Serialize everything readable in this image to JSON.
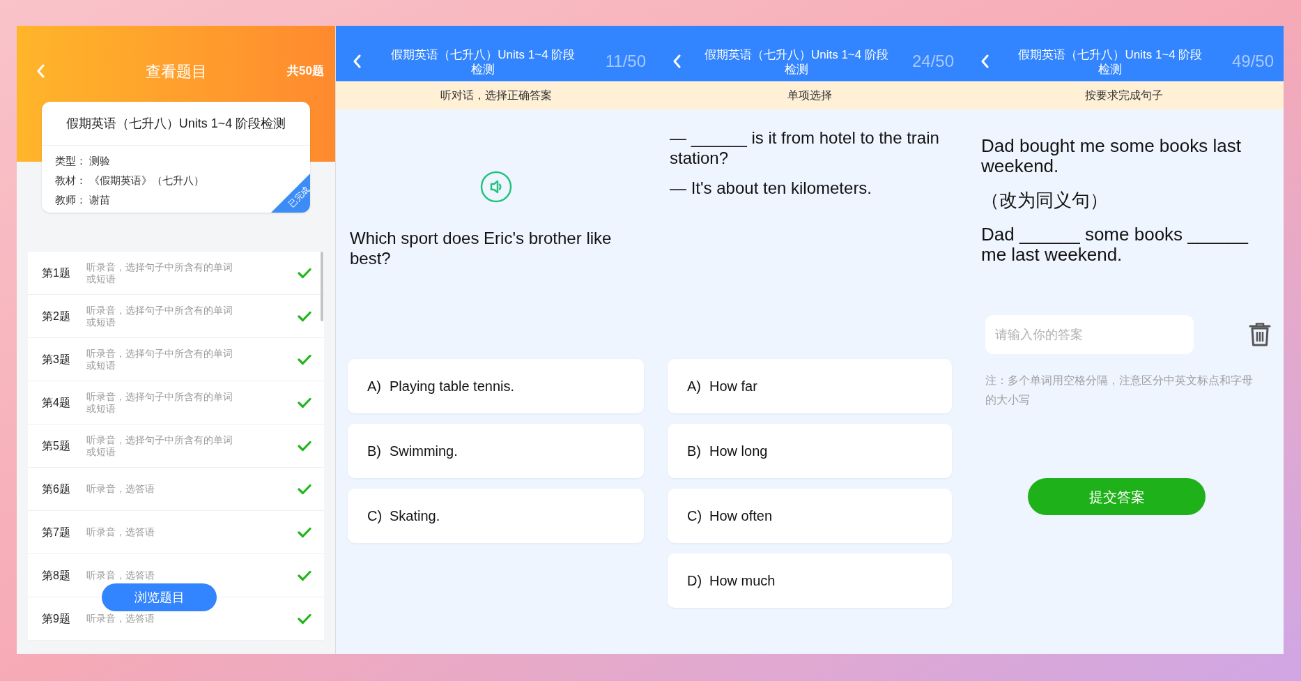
{
  "overview_screen": {
    "title": "查看题目",
    "total": "共50题",
    "card": {
      "title": "假期英语（七升八）Units 1~4 阶段检测",
      "fields": [
        {
          "label": "类型：",
          "value": "测验"
        },
        {
          "label": "教材：",
          "value": "《假期英语》（七升八）"
        },
        {
          "label": "教师：",
          "value": "谢苗"
        }
      ],
      "badge": "已完成"
    },
    "questions": [
      {
        "number": "第1题",
        "description": "听录音，选择句子中所含有的单词或短语",
        "done": true
      },
      {
        "number": "第2题",
        "description": "听录音，选择句子中所含有的单词或短语",
        "done": true
      },
      {
        "number": "第3题",
        "description": "听录音，选择句子中所含有的单词或短语",
        "done": true
      },
      {
        "number": "第4题",
        "description": "听录音，选择句子中所含有的单词或短语",
        "done": true
      },
      {
        "number": "第5题",
        "description": "听录音，选择句子中所含有的单词或短语",
        "done": true
      },
      {
        "number": "第6题",
        "description": "听录音，选答语",
        "done": true
      },
      {
        "number": "第7题",
        "description": "听录音，选答语",
        "done": true
      },
      {
        "number": "第8题",
        "description": "听录音，选答语",
        "done": true
      },
      {
        "number": "第9题",
        "description": "听录音，选答语",
        "done": true
      }
    ],
    "browse_button": "浏览题目"
  },
  "question_screens": [
    {
      "kind": "audio_choice",
      "title": "假期英语（七升八）Units 1~4 阶段检测",
      "progress": "11/50",
      "section": "听对话，选择正确答案",
      "prompt_lines": [
        "Which sport does Eric's brother like best?"
      ],
      "options": [
        {
          "letter": "A)",
          "text": "Playing table tennis."
        },
        {
          "letter": "B)",
          "text": "Swimming."
        },
        {
          "letter": "C)",
          "text": "Skating."
        }
      ]
    },
    {
      "kind": "choice",
      "title": "假期英语（七升八）Units 1~4 阶段检测",
      "progress": "24/50",
      "section": "单项选择",
      "prompt_lines": [
        "— ______ is it from hotel to the train station?",
        "— It's about ten kilometers."
      ],
      "options": [
        {
          "letter": "A)",
          "text": "How far"
        },
        {
          "letter": "B)",
          "text": "How long"
        },
        {
          "letter": "C)",
          "text": "How often"
        },
        {
          "letter": "D)",
          "text": "How much"
        }
      ]
    },
    {
      "kind": "fill_in",
      "title": "假期英语（七升八）Units 1~4 阶段检测",
      "progress": "49/50",
      "section": "按要求完成句子",
      "prompt_lines": [
        "Dad bought me some books last weekend.",
        "（改为同义句）",
        "Dad ______ some books ______ me last weekend."
      ],
      "placeholder": "请输入你的答案",
      "note": "注：多个单词用空格分隔，注意区分中英文标点和字母的大小写",
      "submit_button": "提交答案"
    }
  ]
}
